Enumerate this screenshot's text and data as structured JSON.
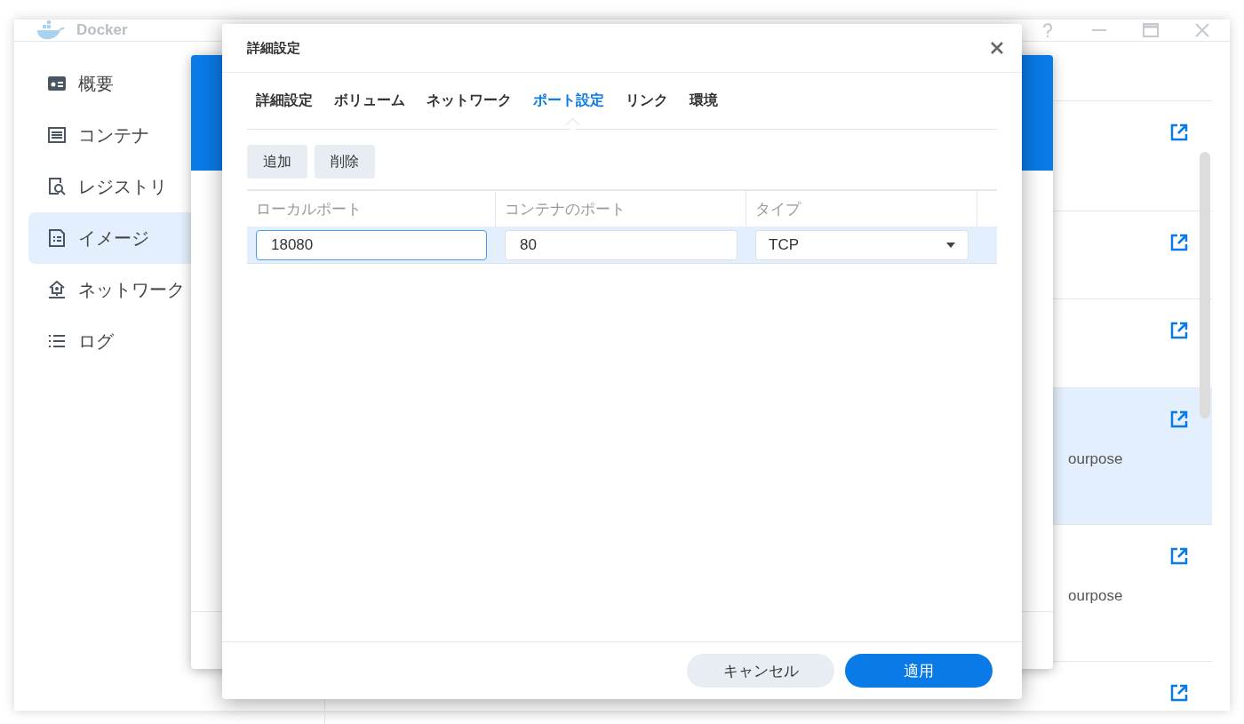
{
  "app": {
    "title": "Docker",
    "sidebar": [
      {
        "label": "概要",
        "selected": false
      },
      {
        "label": "コンテナ",
        "selected": false
      },
      {
        "label": "レジストリ",
        "selected": false
      },
      {
        "label": "イメージ",
        "selected": true
      },
      {
        "label": "ネットワーク",
        "selected": false
      },
      {
        "label": "ログ",
        "selected": false
      }
    ],
    "list_rows": [
      {
        "selected": false
      },
      {
        "selected": false
      },
      {
        "selected": false
      },
      {
        "selected": true,
        "description": "ourpose"
      },
      {
        "selected": false,
        "description": "ourpose"
      },
      {
        "selected": false
      }
    ]
  },
  "dialog": {
    "title": "詳細設定",
    "tabs": [
      {
        "label": "詳細設定",
        "selected": false
      },
      {
        "label": "ボリューム",
        "selected": false
      },
      {
        "label": "ネットワーク",
        "selected": false
      },
      {
        "label": "ポート設定",
        "selected": true
      },
      {
        "label": "リンク",
        "selected": false
      },
      {
        "label": "環境",
        "selected": false
      }
    ],
    "toolbar_buttons": [
      "追加",
      "削除"
    ],
    "table": {
      "columns": [
        "ローカルポート",
        "コンテナのポート",
        "タイプ"
      ],
      "rows": [
        {
          "selected": true,
          "local_port": {
            "value": "18080",
            "focused": true
          },
          "container_port": {
            "value": "80",
            "focused": false
          },
          "type": "TCP"
        }
      ]
    },
    "footer_buttons": [
      {
        "label": "キャンセル",
        "kind": "secondary"
      },
      {
        "label": "適用",
        "kind": "primary"
      }
    ]
  }
}
